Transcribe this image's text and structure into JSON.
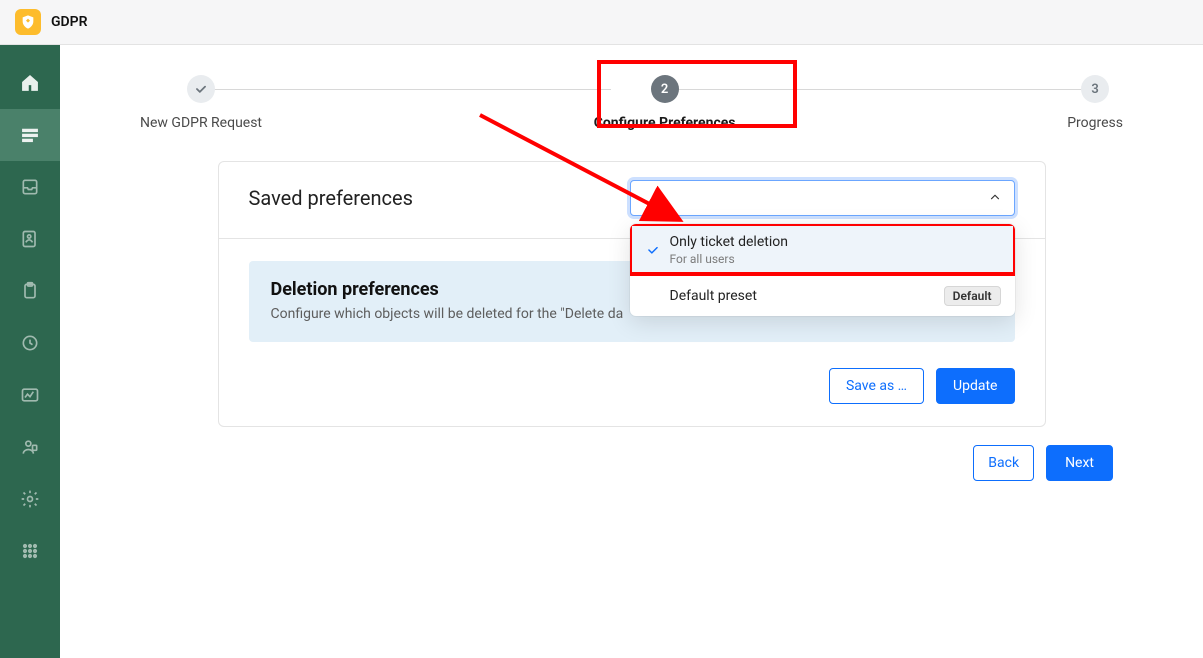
{
  "header": {
    "app_title": "GDPR"
  },
  "stepper": {
    "step1": {
      "label": "New GDPR Request"
    },
    "step2": {
      "label": "Configure Preferences",
      "number": "2"
    },
    "step3": {
      "label": "Progress",
      "number": "3"
    }
  },
  "card": {
    "header_title": "Saved preferences",
    "pref_title": "Deletion preferences",
    "pref_desc": "Configure which objects will be deleted for the \"Delete da",
    "save_as_label": "Save as …",
    "update_label": "Update"
  },
  "select": {
    "value": "",
    "options": [
      {
        "title": "Only ticket deletion",
        "subtitle": "For all users",
        "selected": true
      },
      {
        "title": "Default preset",
        "badge": "Default",
        "selected": false
      }
    ]
  },
  "page_actions": {
    "back_label": "Back",
    "next_label": "Next"
  },
  "sidebar": {
    "items": [
      "home",
      "list",
      "inbox",
      "contact",
      "clipboard",
      "clock",
      "chart",
      "agent",
      "settings",
      "apps"
    ]
  }
}
